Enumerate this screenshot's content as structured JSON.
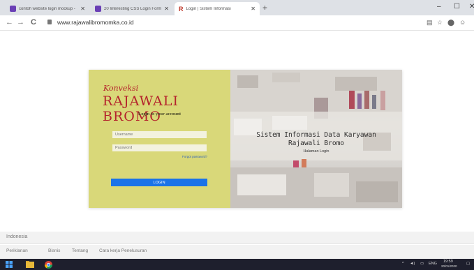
{
  "browser": {
    "tabs": [
      {
        "label": "contoh website login mockup - ",
        "color": "#6a3fb5",
        "active": false
      },
      {
        "label": "20 Interesting CSS Login Form D",
        "color": "#6a3fb5",
        "active": false
      },
      {
        "label": "Login | Sistem Informasi",
        "color": "#c0392b",
        "active": true
      }
    ],
    "tab_favicon_active_glyph": "R",
    "new_tab_glyph": "+",
    "url": "www.rajawalibromomka.co.id",
    "window_controls": {
      "minimize": "–",
      "maximize": "☐",
      "close": "✕"
    },
    "nav": {
      "back": "←",
      "forward": "→",
      "reload": "C"
    }
  },
  "login": {
    "brand_script": "Konveksi",
    "brand_name": "RAJAWALI BROMO",
    "heading": "Login to your account",
    "username_placeholder": "Username",
    "password_placeholder": "Password",
    "forgot_label": "Forgot password?",
    "login_button": "LOGIN",
    "overlay_title": "Sistem Informasi Data Karyawan",
    "overlay_subtitle": "Rajawali Bromo",
    "overlay_small": "Halaman Login",
    "colors": {
      "brand": "#b4232c",
      "panel": "#d9d879",
      "button": "#1a73e8"
    }
  },
  "footer": {
    "country": "Indonesia",
    "links": [
      "Periklanan",
      "Bisnis",
      "Tentang",
      "Cara kerja Penelusuran"
    ]
  },
  "taskbar": {
    "tray_lang": "ENG",
    "time": "19:59",
    "date": "20/01/2020"
  }
}
